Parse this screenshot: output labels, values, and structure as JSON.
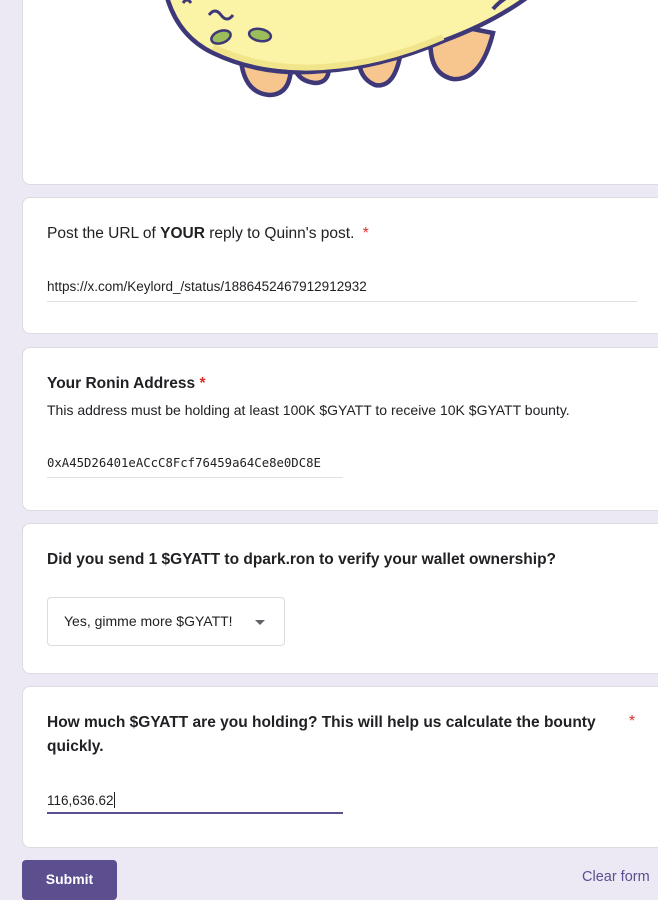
{
  "questions": {
    "url": {
      "title_prefix": "Post the URL of ",
      "title_emphasis": "YOUR",
      "title_suffix": " reply to Quinn's post.",
      "required_mark": "*",
      "answer": "https://x.com/Keylord_/status/1886452467912912932"
    },
    "ronin": {
      "title": "Your Ronin Address",
      "required_mark": "*",
      "help": "This address must be holding at least 100K $GYATT to receive 10K $GYATT bounty.",
      "answer": "0xA45D26401eACcC8Fcf76459a64Ce8e0DC8E"
    },
    "verify": {
      "title": "Did you send 1 $GYATT to dpark.ron to verify your wallet ownership?",
      "selected": "Yes, gimme more $GYATT!"
    },
    "holding": {
      "title": "How much $GYATT are you holding? This will help us calculate the bounty quickly.",
      "required_mark": "*",
      "answer": "116,636.62"
    }
  },
  "footer": {
    "submit_label": "Submit",
    "clear_label": "Clear form"
  },
  "colors": {
    "accent": "#5c4e8f",
    "background": "#ede9f4",
    "required": "#d93025"
  }
}
